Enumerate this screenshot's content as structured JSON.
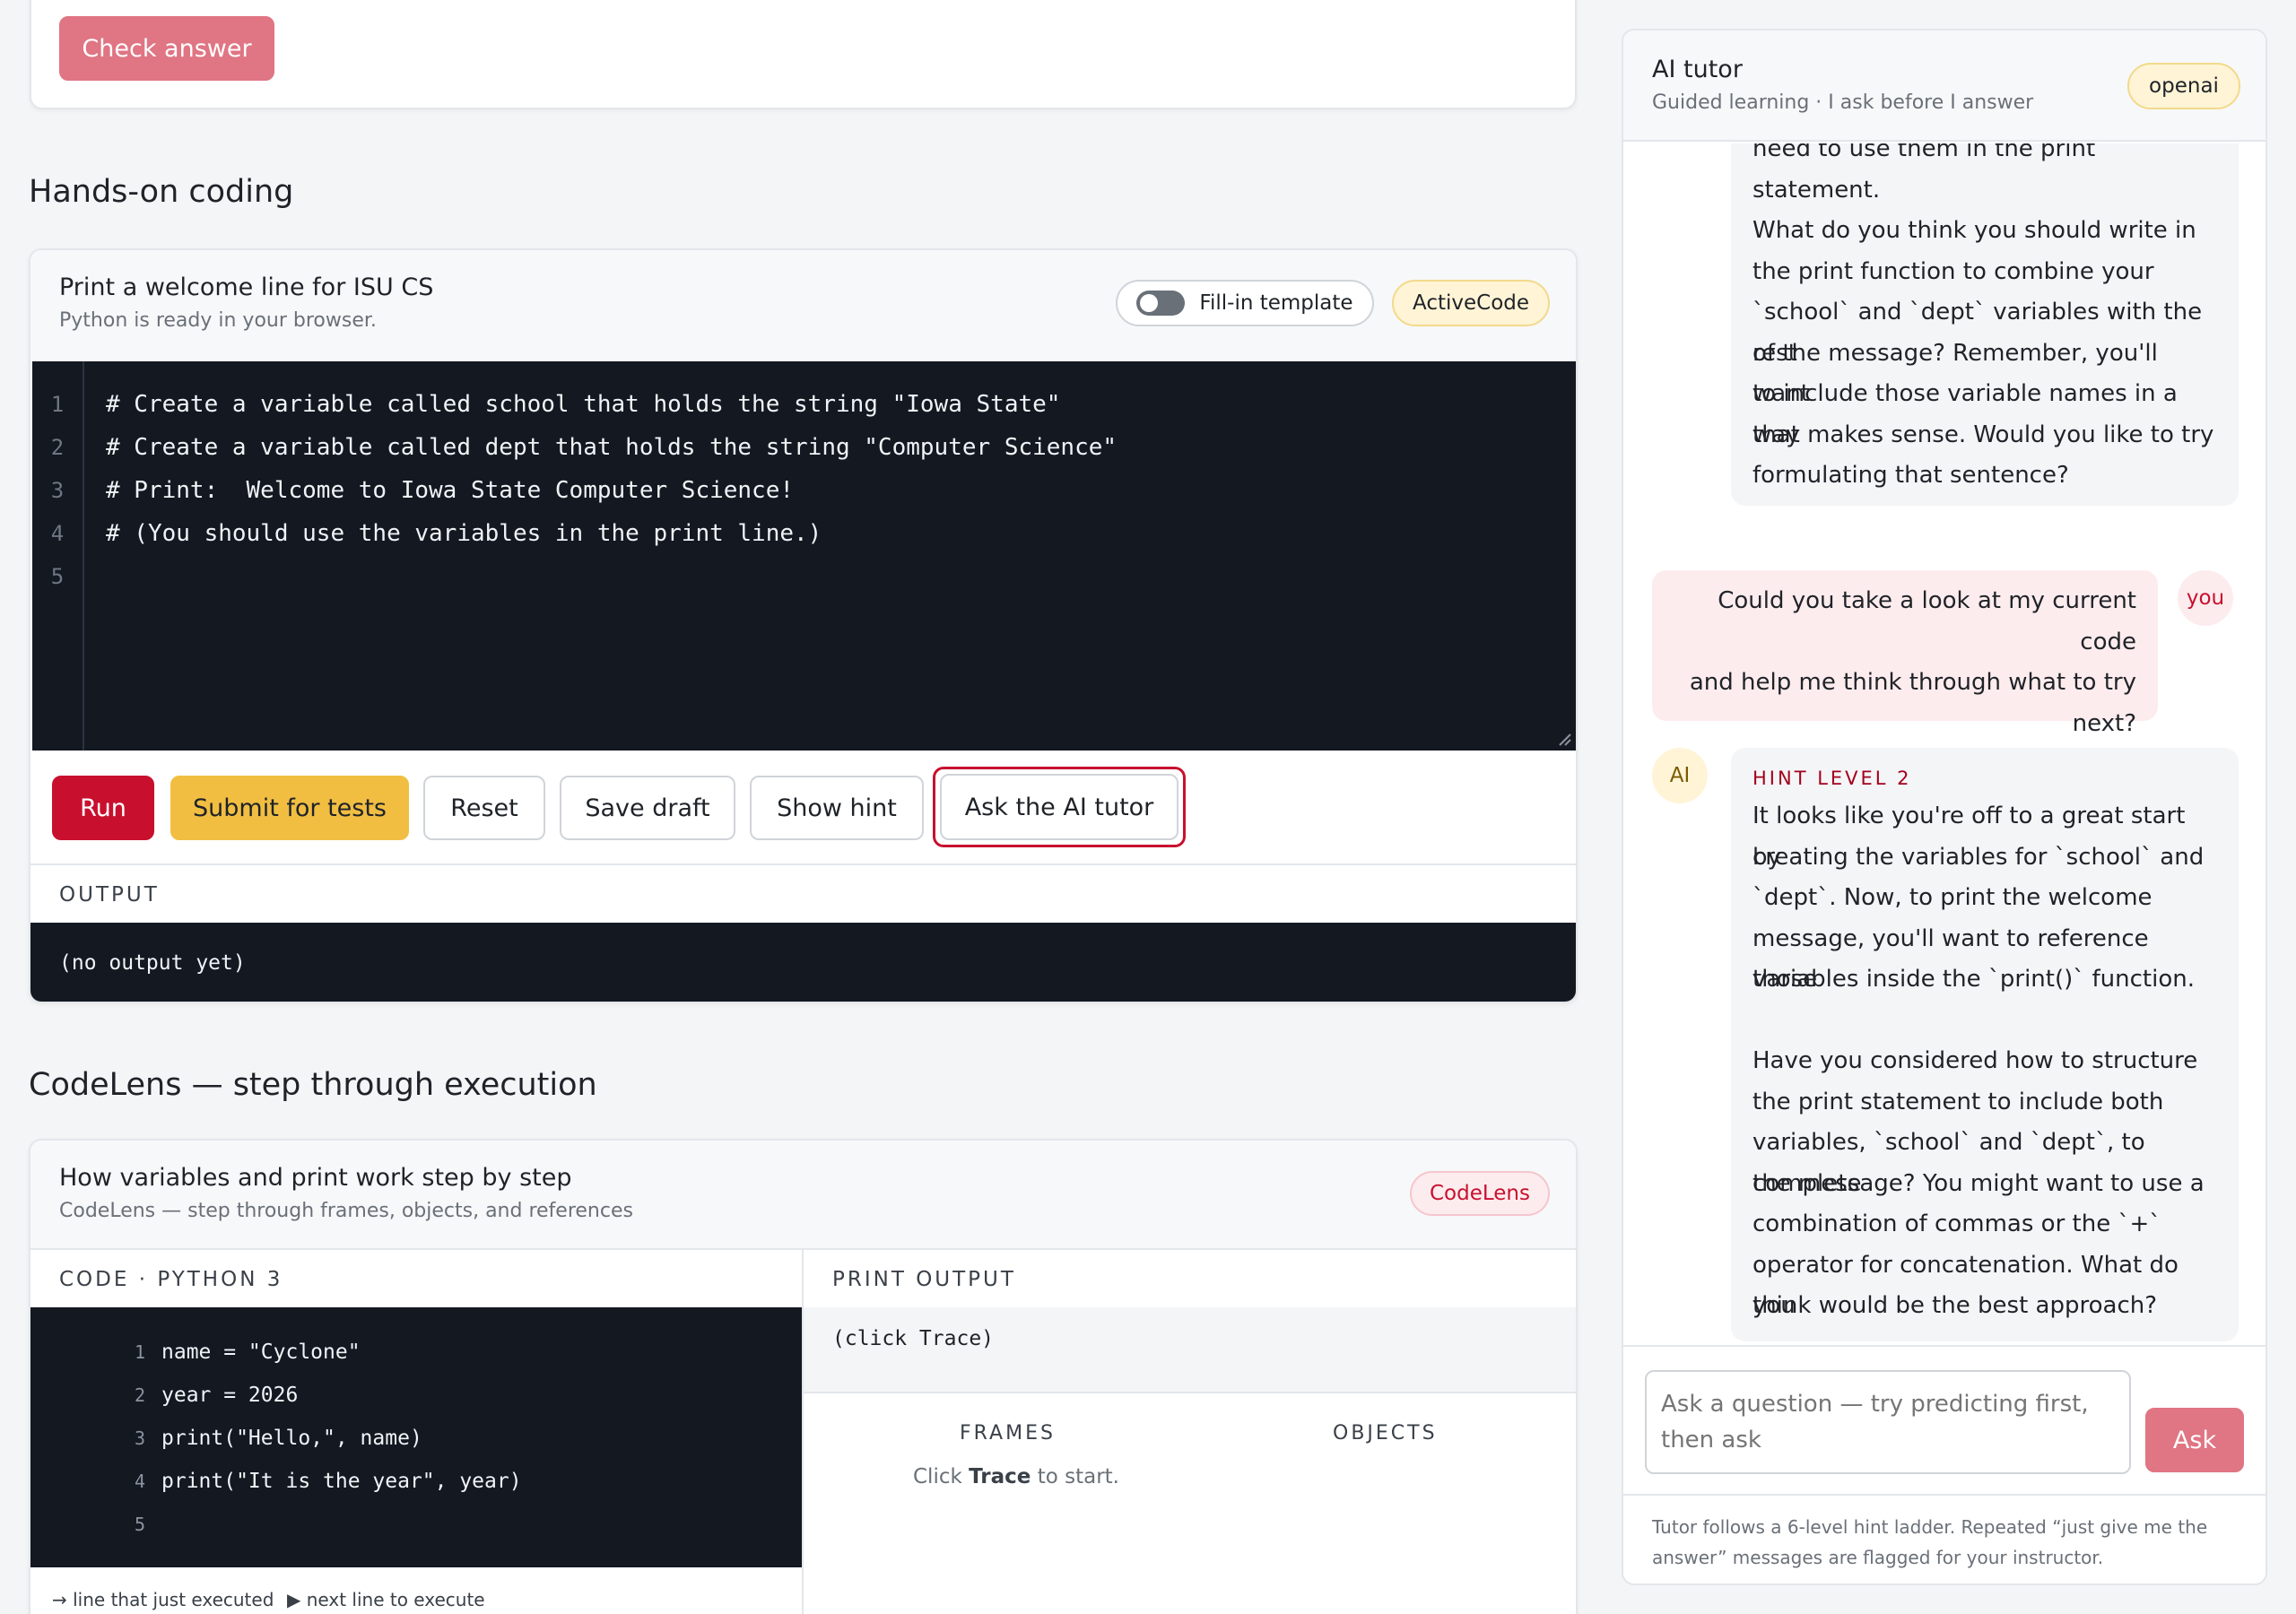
{
  "top_card": {
    "check_answer_label": "Check answer"
  },
  "hands_on": {
    "section_title": "Hands-on coding",
    "card_title": "Print a welcome line for ISU CS",
    "card_subtitle": "Python is ready in your browser.",
    "fill_in_label": "Fill-in template",
    "badge": "ActiveCode",
    "line_numbers": [
      "1",
      "2",
      "3",
      "4",
      "5"
    ],
    "code_lines": [
      "# Create a variable called school that holds the string \"Iowa State\"",
      "# Create a variable called dept that holds the string \"Computer Science\"",
      "# Print:  Welcome to Iowa State Computer Science!",
      "# (You should use the variables in the print line.)",
      ""
    ],
    "buttons": {
      "run": "Run",
      "submit": "Submit for tests",
      "reset": "Reset",
      "save_draft": "Save draft",
      "show_hint": "Show hint",
      "ask_tutor": "Ask the AI tutor"
    },
    "output_label": "OUTPUT",
    "output_text": "(no output yet)"
  },
  "codelens": {
    "section_title": "CodeLens — step through execution",
    "card_title": "How variables and print work step by step",
    "card_subtitle": "CodeLens — step through frames, objects, and references",
    "badge": "CodeLens",
    "code_label": "CODE · PYTHON 3",
    "lines": [
      {
        "n": "1",
        "code": "name = \"Cyclone\""
      },
      {
        "n": "2",
        "code": "year = 2026"
      },
      {
        "n": "3",
        "code": "print(\"Hello,\", name)"
      },
      {
        "n": "4",
        "code": "print(\"It is the year\", year)"
      },
      {
        "n": "5",
        "code": ""
      }
    ],
    "print_output_label": "PRINT OUTPUT",
    "print_output_text": "(click Trace)",
    "frames_label": "FRAMES",
    "objects_label": "OBJECTS",
    "click_prefix": "Click ",
    "click_strong": "Trace",
    "click_suffix": " to start.",
    "legend_executed": "→ line that just executed",
    "legend_next": "▶ next line to execute"
  },
  "tutor": {
    "title": "AI tutor",
    "subtitle": "Guided learning · I ask before I answer",
    "provider_badge": "openai",
    "msg1_lines": [
      "need to use them in the print statement.",
      "",
      "What do you think you should write in",
      "the print function to combine your",
      "`school` and `dept` variables with the rest",
      "of the message? Remember, you'll want",
      "to include those variable names in a way",
      "that makes sense. Would you like to try",
      "formulating that sentence?"
    ],
    "you_avatar": "you",
    "user_msg_lines": [
      "Could you take a look at my current code",
      "and help me think through what to try",
      "next?"
    ],
    "ai_avatar": "AI",
    "hint_level": "HINT LEVEL 2",
    "msg2_lines": [
      "It looks like you're off to a great start by",
      "creating the variables for `school` and",
      "`dept`. Now, to print the welcome",
      "message, you'll want to reference those",
      "variables inside the `print()` function.",
      "",
      "Have you considered how to structure",
      "the print statement to include both",
      "variables, `school` and `dept`, to complete",
      "the message? You might want to use a",
      "combination of commas or the `+`",
      "operator for concatenation. What do you",
      "think would be the best approach?"
    ],
    "input_placeholder": "Ask a question — try predicting first, then ask",
    "ask_label": "Ask",
    "footer_note": "Tutor follows a 6-level hint ladder. Repeated “just give me the answer” messages are flagged for your instructor."
  }
}
